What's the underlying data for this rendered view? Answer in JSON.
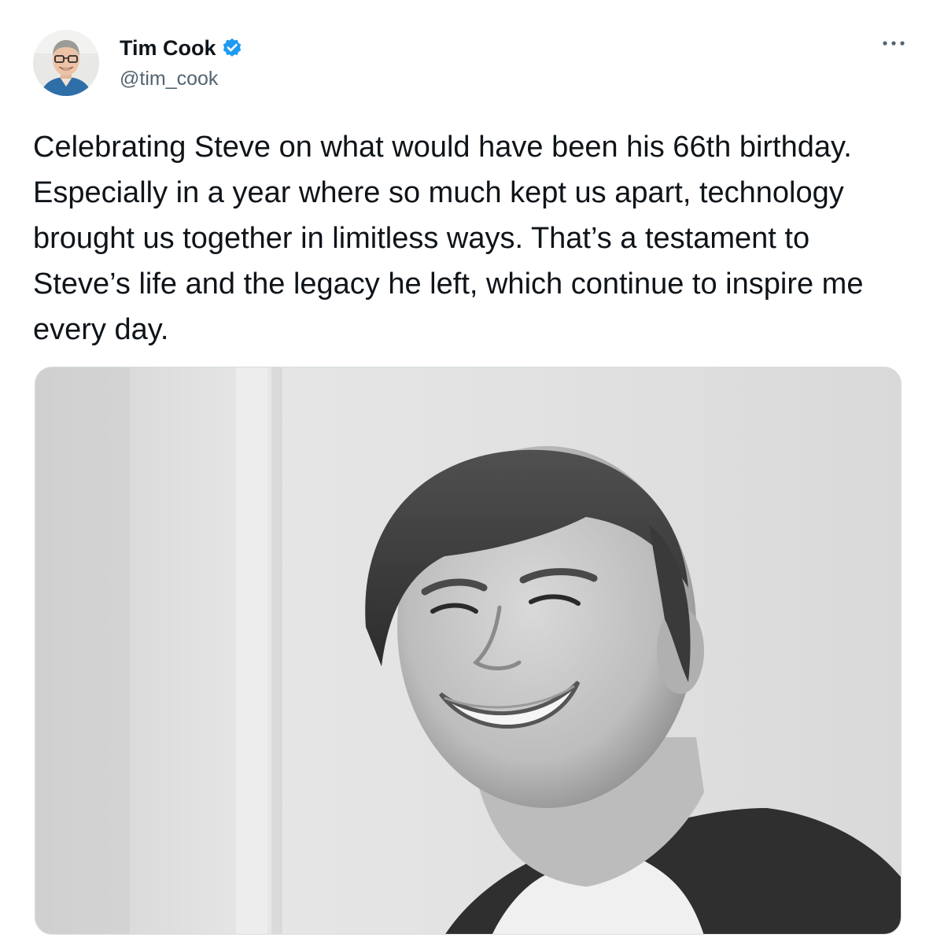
{
  "tweet": {
    "author": {
      "display_name": "Tim Cook",
      "handle": "@tim_cook",
      "verified": true
    },
    "text": "Celebrating Steve on what would have been his 66th birthday. Especially in a year where so much kept us apart, technology brought us together in limitless ways. That’s a testament to Steve’s life and the legacy he left, which continue to inspire me every day.",
    "media": {
      "type": "photo",
      "style": "black-and-white portrait"
    }
  },
  "icons": {
    "verified": "verified-badge-icon",
    "more": "more-options-icon"
  },
  "colors": {
    "text_primary": "#0f1419",
    "text_secondary": "#536471",
    "verified_blue": "#1d9bf0"
  }
}
